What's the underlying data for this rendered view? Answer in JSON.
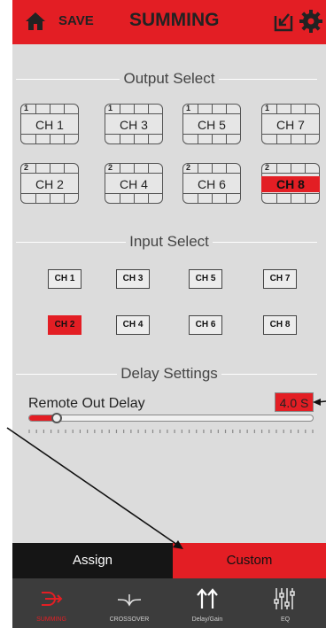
{
  "header": {
    "save_label": "SAVE",
    "title": "SUMMING"
  },
  "output_select": {
    "title": "Output Select",
    "channels": [
      {
        "num": "1",
        "label": "CH 1"
      },
      {
        "num": "1",
        "label": "CH 3"
      },
      {
        "num": "1",
        "label": "CH 5"
      },
      {
        "num": "1",
        "label": "CH 7"
      },
      {
        "num": "2",
        "label": "CH 2"
      },
      {
        "num": "2",
        "label": "CH 4"
      },
      {
        "num": "2",
        "label": "CH 6"
      },
      {
        "num": "2",
        "label": "CH 8"
      }
    ],
    "selected": "CH 8"
  },
  "input_select": {
    "title": "Input Select",
    "channels": [
      "CH 1",
      "CH 3",
      "CH 5",
      "CH 7",
      "CH 2",
      "CH 4",
      "CH 6",
      "CH 8"
    ],
    "selected": "CH 2"
  },
  "delay": {
    "title": "Delay Settings",
    "label": "Remote Out Delay",
    "value": "4.0 S",
    "slider_fraction": 0.1
  },
  "mode_tabs": {
    "assign": "Assign",
    "custom": "Custom",
    "selected": "Custom"
  },
  "nav": [
    {
      "label": "SUMMING",
      "icon": "summing-icon"
    },
    {
      "label": "CROSSOVER",
      "icon": "crossover-icon"
    },
    {
      "label": "Delay/Gain",
      "icon": "delay-gain-icon"
    },
    {
      "label": "EQ",
      "icon": "eq-icon"
    }
  ],
  "colors": {
    "accent": "#e31e24",
    "background": "#dcdcdc",
    "nav": "#3c3c3c"
  }
}
